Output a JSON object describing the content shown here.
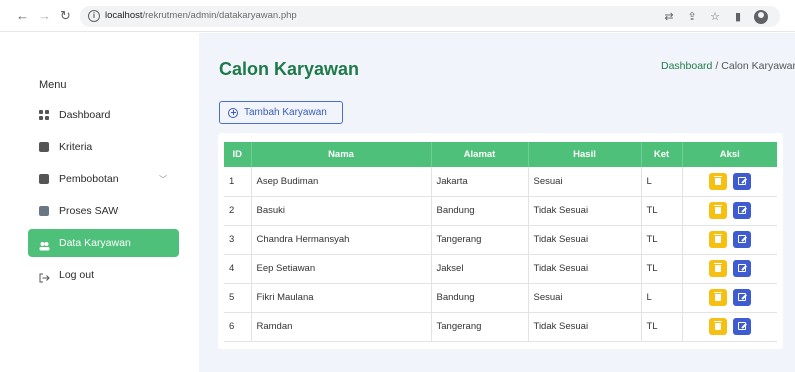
{
  "browser": {
    "url_host": "localhost",
    "url_path": "/rekrutmen/admin/datakaryawan.php"
  },
  "sidebar": {
    "menu_label": "Menu",
    "items": [
      {
        "label": "Dashboard",
        "icon": "dashboard-grid-icon"
      },
      {
        "label": "Kriteria",
        "icon": "document-icon"
      },
      {
        "label": "Pembobotan",
        "icon": "plus-square-icon"
      },
      {
        "label": "Proses SAW",
        "icon": "check-square-icon"
      },
      {
        "label": "Data Karyawan",
        "icon": "users-icon",
        "active": true
      },
      {
        "label": "Log out",
        "icon": "logout-icon"
      }
    ]
  },
  "header": {
    "title": "Calon Karyawan",
    "breadcrumb_home": "Dashboard",
    "breadcrumb_sep": "/",
    "breadcrumb_current": "Calon Karyawan"
  },
  "toolbar": {
    "add_label": "Tambah Karyawan"
  },
  "table": {
    "columns": [
      "ID",
      "Nama",
      "Alamat",
      "Hasil",
      "Ket",
      "Aksi"
    ],
    "rows": [
      {
        "id": "1",
        "nama": "Asep Budiman",
        "alamat": "Jakarta",
        "hasil": "Sesuai",
        "ket": "L"
      },
      {
        "id": "2",
        "nama": "Basuki",
        "alamat": "Bandung",
        "hasil": "Tidak Sesuai",
        "ket": "TL"
      },
      {
        "id": "3",
        "nama": "Chandra Hermansyah",
        "alamat": "Tangerang",
        "hasil": "Tidak Sesuai",
        "ket": "TL"
      },
      {
        "id": "4",
        "nama": "Eep Setiawan",
        "alamat": "Jaksel",
        "hasil": "Tidak Sesuai",
        "ket": "TL"
      },
      {
        "id": "5",
        "nama": "Fikri Maulana",
        "alamat": "Bandung",
        "hasil": "Sesuai",
        "ket": "L"
      },
      {
        "id": "6",
        "nama": "Ramdan",
        "alamat": "Tangerang",
        "hasil": "Tidak Sesuai",
        "ket": "TL"
      }
    ]
  },
  "colors": {
    "accent_green": "#4ec07a",
    "title_green": "#1f7a4a",
    "delete_yellow": "#f5c012",
    "edit_blue": "#3e5bd0"
  }
}
